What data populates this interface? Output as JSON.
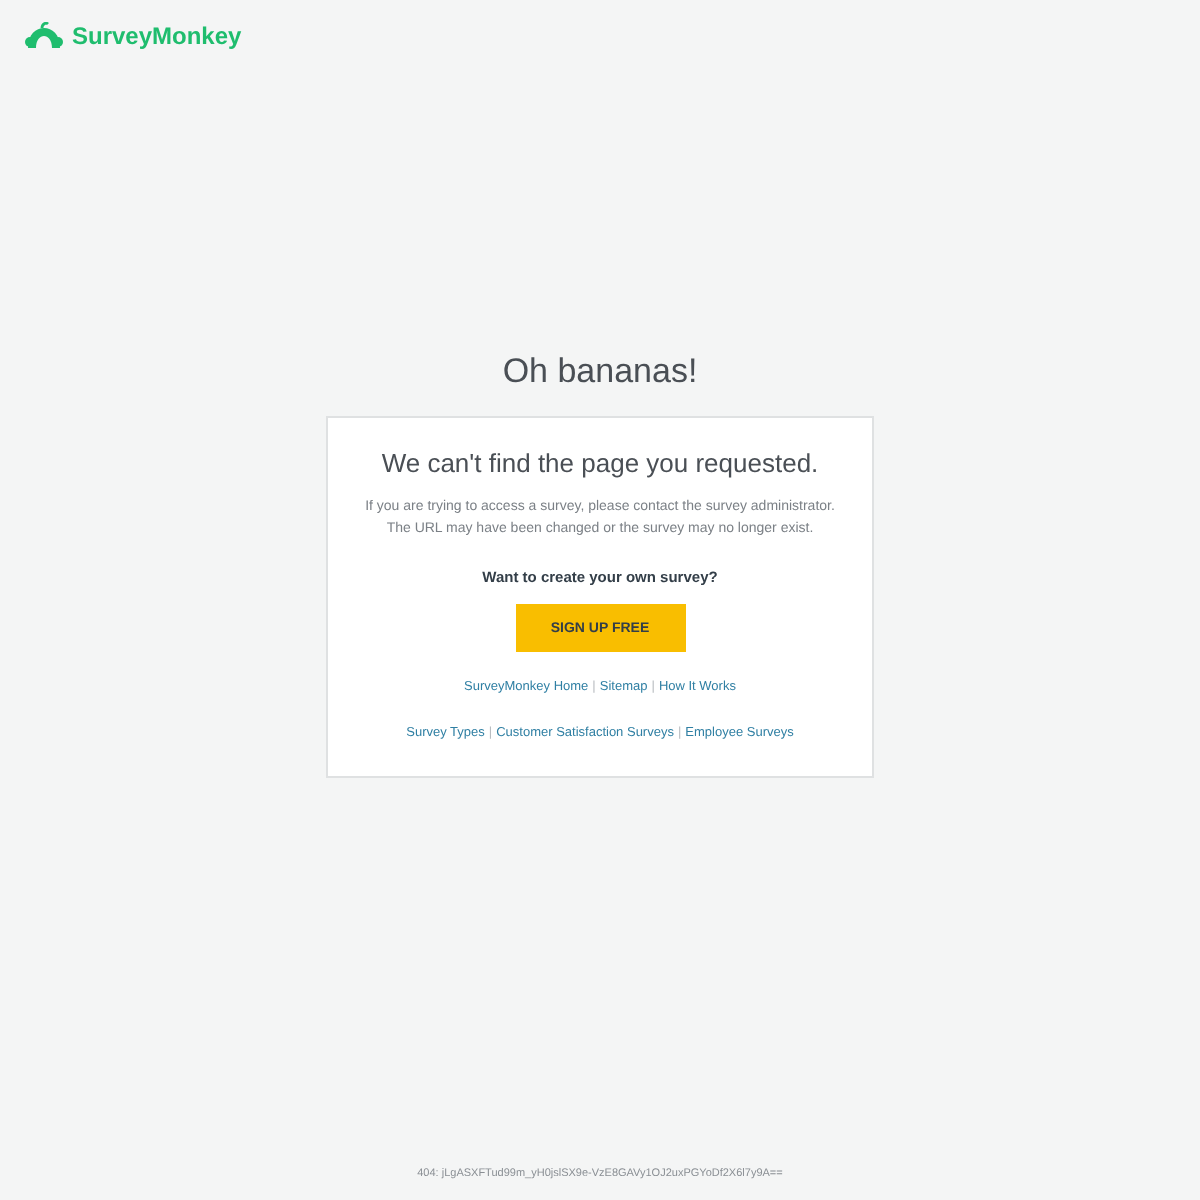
{
  "header": {
    "logo_text": "SurveyMonkey"
  },
  "heading": "Oh bananas!",
  "card": {
    "title": "We can't find the page you requested.",
    "message": "If you are trying to access a survey, please contact the survey administrator. The URL may have been changed or the survey may no longer exist.",
    "prompt": "Want to create your own survey?",
    "button": "SIGN UP FREE",
    "separator": "|",
    "link_rows": [
      [
        "SurveyMonkey Home",
        "Sitemap",
        "How It Works"
      ],
      [
        "Survey Types",
        "Customer Satisfaction Surveys",
        "Employee Surveys"
      ]
    ]
  },
  "footer": "404: jLgASXFTud99m_yH0jslSX9e-VzE8GAVy1OJ2uxPGYoDf2X6l7y9A=="
}
